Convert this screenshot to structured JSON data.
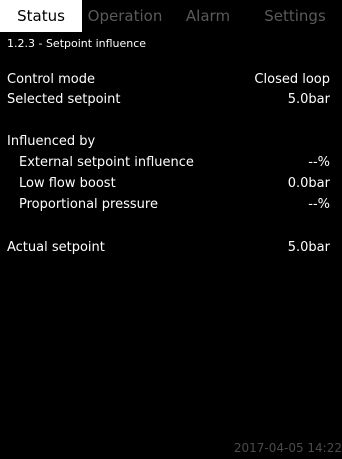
{
  "tabs": [
    {
      "label": "Status",
      "active": true
    },
    {
      "label": "Operation",
      "active": false
    },
    {
      "label": "Alarm",
      "active": false
    },
    {
      "label": "Settings",
      "active": false
    }
  ],
  "breadcrumb": "1.2.3 - Setpoint influence",
  "control_mode": {
    "label": "Control mode",
    "value": "Closed loop"
  },
  "selected_setpoint": {
    "label": "Selected setpoint",
    "value": "5.0bar"
  },
  "influenced_by": {
    "heading": "Influenced by",
    "items": [
      {
        "label": "External setpoint influence",
        "value": "--%"
      },
      {
        "label": "Low flow boost",
        "value": "0.0bar"
      },
      {
        "label": "Proportional pressure",
        "value": "--%"
      }
    ]
  },
  "actual_setpoint": {
    "label": "Actual setpoint",
    "value": "5.0bar"
  },
  "timestamp": "2017-04-05 14:22",
  "colors": {
    "background": "#000000",
    "active_tab_bg": "#ffffff",
    "inactive_tab_text": "#5a5a5a",
    "text": "#ffffff"
  }
}
